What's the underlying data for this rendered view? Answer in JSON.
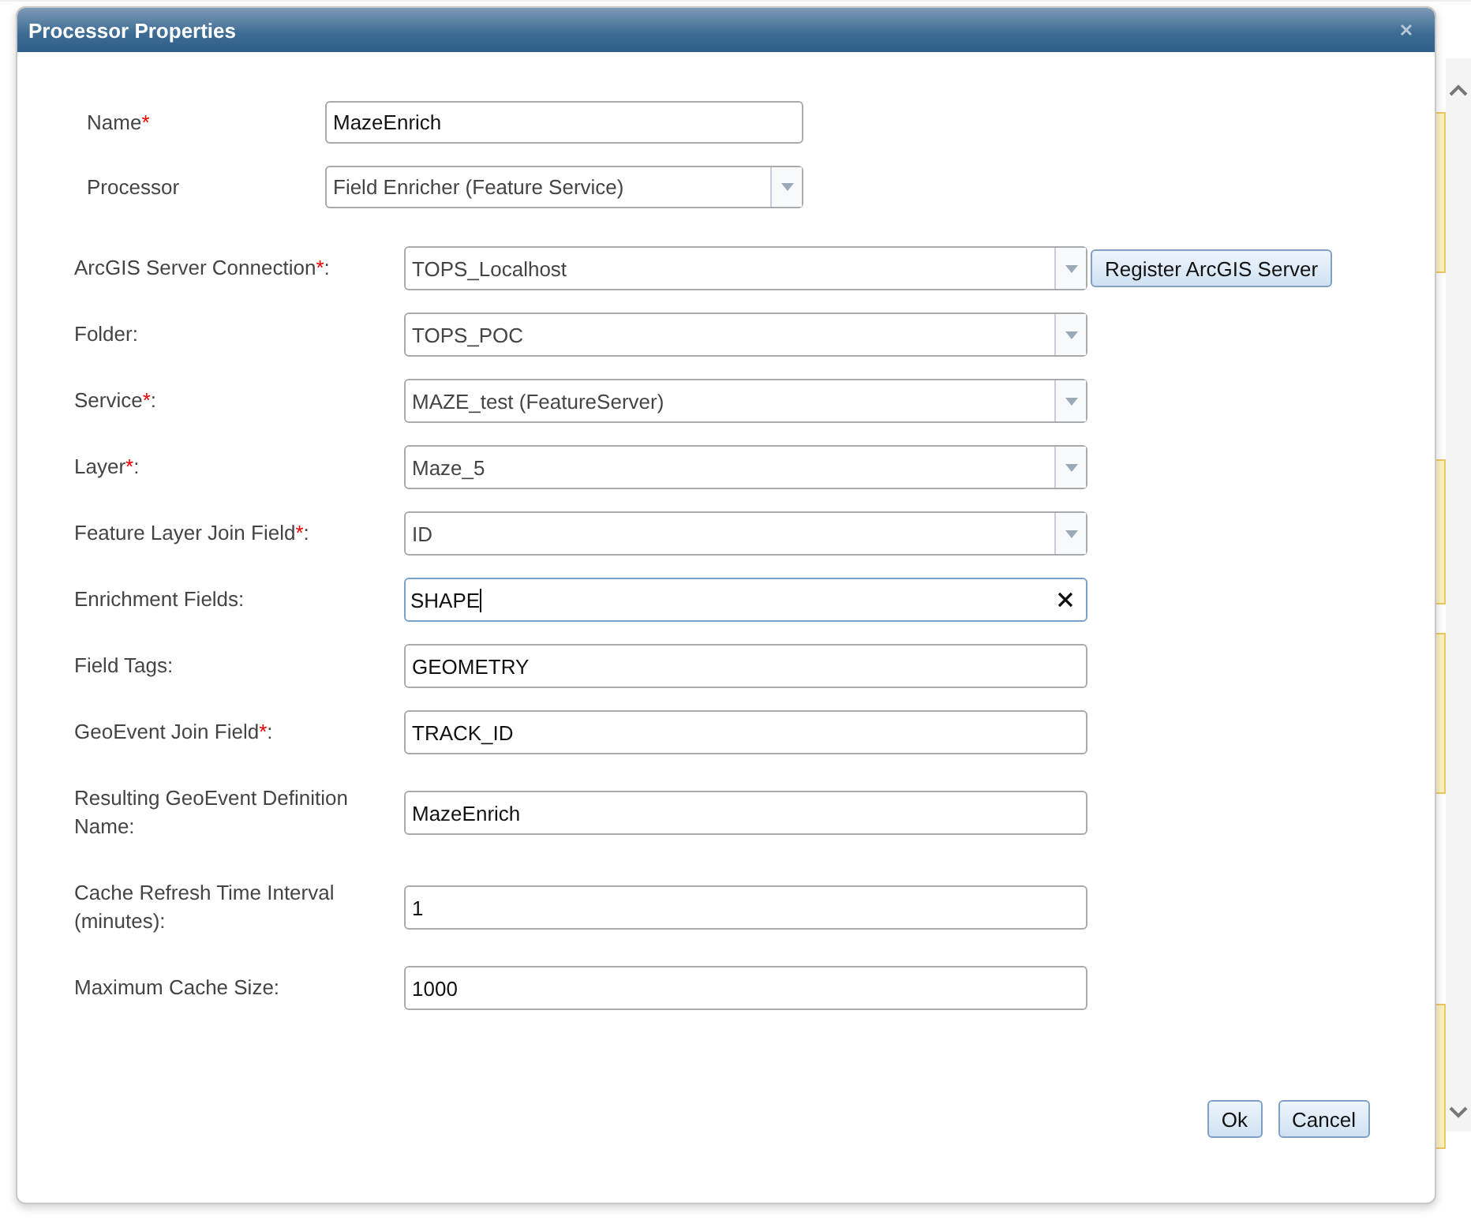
{
  "dialog": {
    "title": "Processor Properties",
    "header_fields": [
      {
        "label": "Name",
        "asterisk": "*",
        "kind": "text",
        "value": "MazeEnrich"
      },
      {
        "label": "Processor",
        "kind": "select",
        "value": "Field Enricher (Feature Service)"
      }
    ],
    "fields": [
      {
        "label": "ArcGIS Server Connection",
        "asterisk": "*",
        "colon": ":",
        "kind": "select",
        "value": "TOPS_Localhost",
        "focused": false,
        "button": "Register ArcGIS Server"
      },
      {
        "label": "Folder:",
        "kind": "select",
        "value": "TOPS_POC",
        "focused": false
      },
      {
        "label": "Service",
        "asterisk": "*",
        "colon": ":",
        "kind": "select",
        "value": "MAZE_test (FeatureServer)",
        "focused": false
      },
      {
        "label": "Layer",
        "asterisk": "*",
        "colon": ":",
        "kind": "select",
        "value": "Maze_5",
        "focused": false
      },
      {
        "label": "Feature Layer Join Field",
        "asterisk": "*",
        "colon": ":",
        "kind": "select",
        "value": "ID",
        "focused": false
      },
      {
        "label": "Enrichment Fields:",
        "kind": "clearable",
        "value": "SHAPE",
        "focused": true
      },
      {
        "label": "Field Tags:",
        "kind": "text",
        "value": "GEOMETRY",
        "focused": false
      },
      {
        "label": "GeoEvent Join Field",
        "asterisk": "*",
        "colon": ":",
        "kind": "text",
        "value": "TRACK_ID",
        "focused": false
      },
      {
        "label": "Resulting GeoEvent Definition Name:",
        "kind": "text",
        "value": "MazeEnrich",
        "focused": false
      },
      {
        "label": "Cache Refresh Time Interval (minutes):",
        "kind": "text",
        "value": "1",
        "focused": false
      },
      {
        "label": "Maximum Cache Size:",
        "kind": "text",
        "value": "1000",
        "focused": false
      }
    ],
    "buttons": [
      "Ok",
      "Cancel"
    ]
  }
}
